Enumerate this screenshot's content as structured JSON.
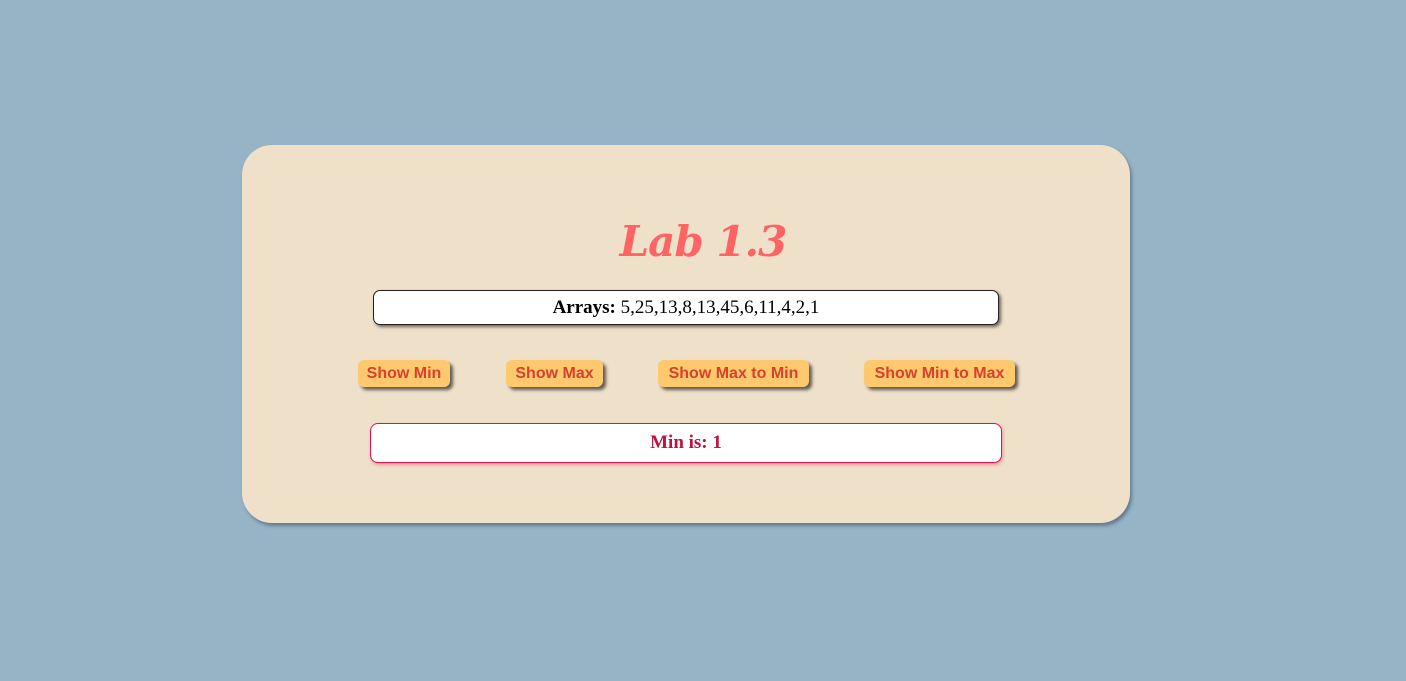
{
  "page": {
    "title": "Lab 1.3"
  },
  "arrays": {
    "label": "Arrays:",
    "values": "5,25,13,8,13,45,6,11,4,2,1"
  },
  "buttons": {
    "show_min": "Show Min",
    "show_max": "Show Max",
    "show_max_to_min": "Show Max to Min",
    "show_min_to_max": "Show Min to Max"
  },
  "result": {
    "text": "Min is: 1"
  },
  "colors": {
    "background": "#96b4c6",
    "card": "#efe0ca",
    "title": "#ff6464",
    "button": "#fec96e",
    "button_text": "#d8412c",
    "result_text": "#c0103c"
  }
}
